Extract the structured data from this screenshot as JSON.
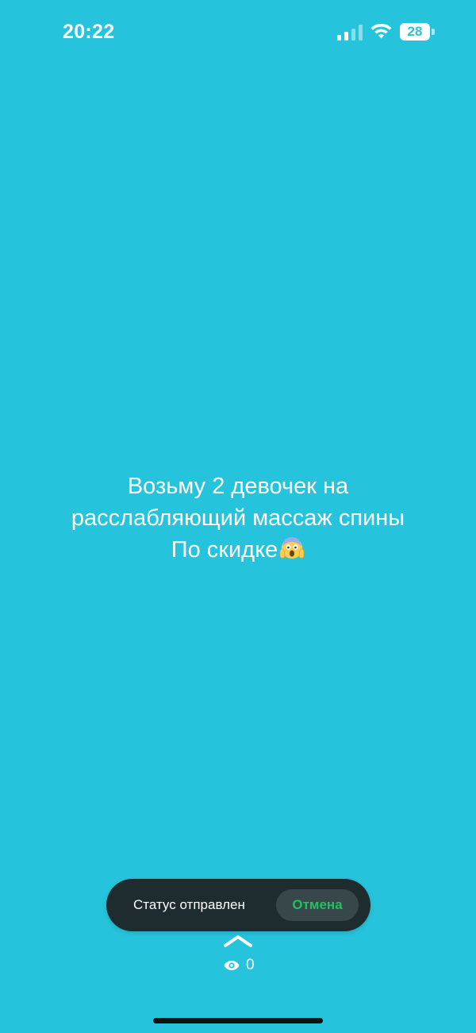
{
  "status_bar": {
    "time": "20:22",
    "battery_level": "28",
    "icons": [
      "signal-icon",
      "wifi-icon",
      "battery-icon"
    ]
  },
  "status_post": {
    "line1": "Возьму 2 девочек на",
    "line2": "расслабляющий массаж спины",
    "line3": "По скидке",
    "emoji": "face-screaming-in-fear-emoji",
    "background_color": "#26C4DC"
  },
  "toast": {
    "message": "Статус отправлен",
    "undo_label": "Отмена",
    "undo_color": "#21C063"
  },
  "footer": {
    "views_count": "0",
    "icons": [
      "chevron-up-icon",
      "eye-icon"
    ]
  }
}
